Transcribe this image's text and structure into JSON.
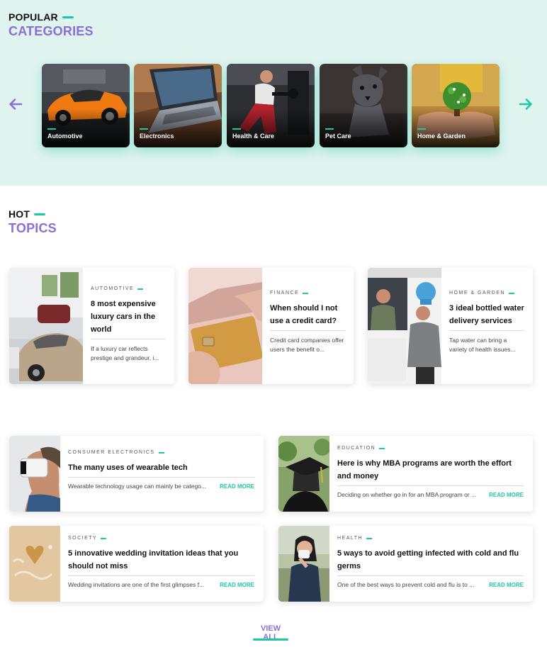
{
  "popular": {
    "small": "POPULAR",
    "big": "CATEGORIES",
    "categories": [
      "Automotive",
      "Electronics",
      "Health & Care",
      "Pet Care",
      "Home & Garden"
    ]
  },
  "hot": {
    "small": "HOT",
    "big": "TOPICS"
  },
  "top_articles": [
    {
      "tag": "AUTOMOTIVE",
      "title": "8 most expensive luxury cars in the world",
      "excerpt": "If a luxury car reflects prestige and grandeur, i..."
    },
    {
      "tag": "FINANCE",
      "title": "When should I not use a credit card?",
      "excerpt": "Credit card companies offer users the benefit o..."
    },
    {
      "tag": "HOME & GARDEN",
      "title": "3 ideal bottled water delivery services",
      "excerpt": "Tap water can bring a variety of health issues..."
    }
  ],
  "grid_articles": [
    {
      "tag": "CONSUMER ELECTRONICS",
      "title": "The many uses of wearable tech",
      "excerpt": "Wearable technology usage can mainly be catego...",
      "more": "READ MORE"
    },
    {
      "tag": "EDUCATION",
      "title": "Here is why MBA programs are worth the effort and money",
      "excerpt": "Deciding on whether go in for an MBA program or ...",
      "more": "READ MORE"
    },
    {
      "tag": "SOCIETY",
      "title": "5 innovative wedding invitation ideas that you should not miss",
      "excerpt": "Wedding invitations are one of the first glimpses f...",
      "more": "READ MORE"
    },
    {
      "tag": "HEALTH",
      "title": "5 ways to avoid getting infected with cold and flu germs",
      "excerpt": "One of the best ways to prevent cold and flu is to ...",
      "more": "READ MORE"
    }
  ],
  "view_all": "VIEW ALL",
  "icons": {
    "prev": "arrow-left-icon",
    "next": "arrow-right-icon"
  },
  "colors": {
    "accent": "#1dc9a0",
    "heading": "#8a6fd6",
    "band": "#dff3ef"
  }
}
